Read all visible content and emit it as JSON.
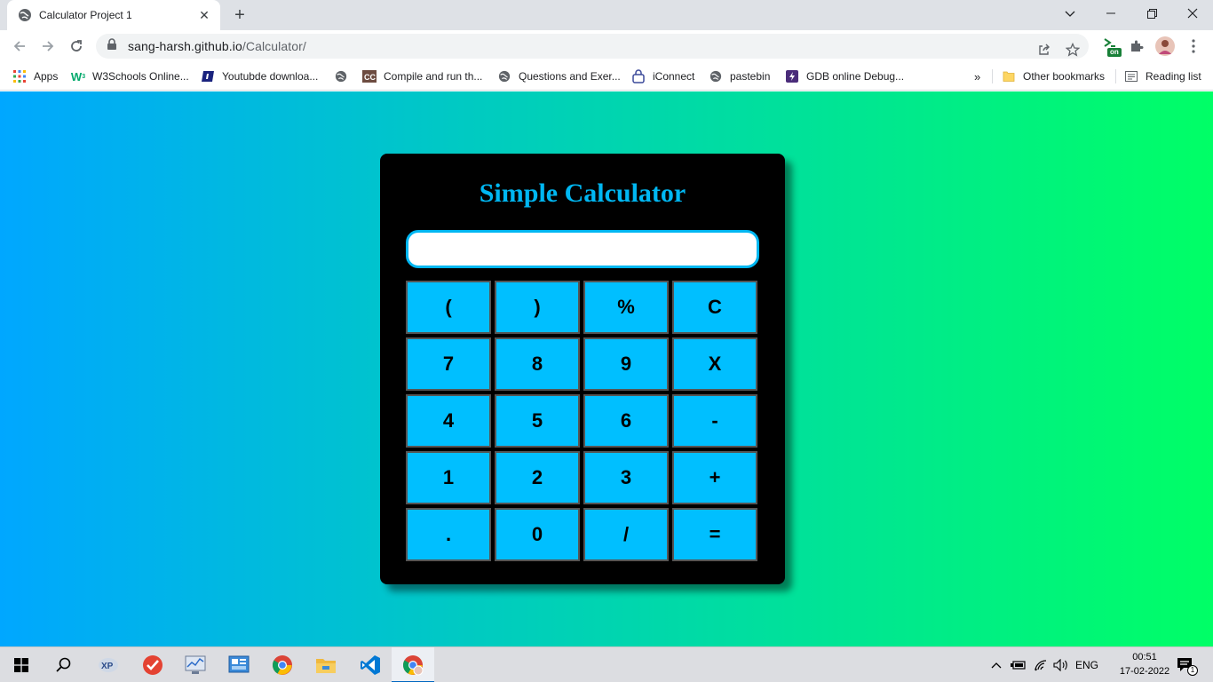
{
  "browser": {
    "tab": {
      "title": "Calculator Project 1"
    },
    "address": {
      "host": "sang-harsh.github.io",
      "path": "/Calculator/"
    },
    "bookmarks": [
      {
        "label": "Apps",
        "icon": "apps-grid-icon"
      },
      {
        "label": "W3Schools Online...",
        "icon": "w3schools-icon"
      },
      {
        "label": "Youtubde downloa...",
        "icon": "bookmark-site-icon"
      },
      {
        "label": "",
        "icon": "globe-icon"
      },
      {
        "label": "Compile and run th...",
        "icon": "cc-icon"
      },
      {
        "label": "Questions and Exer...",
        "icon": "globe-icon"
      },
      {
        "label": "iConnect",
        "icon": "lock-icon"
      },
      {
        "label": "pastebin",
        "icon": "globe-icon"
      },
      {
        "label": "GDB online Debug...",
        "icon": "gdb-icon"
      }
    ],
    "overflow": "»",
    "other_bookmarks": "Other bookmarks",
    "reading_list": "Reading list",
    "extension_badge": "on"
  },
  "calculator": {
    "title": "Simple Calculator",
    "display_value": "",
    "keys": [
      "(",
      ")",
      "%",
      "C",
      "7",
      "8",
      "9",
      "X",
      "4",
      "5",
      "6",
      "-",
      "1",
      "2",
      "3",
      "+",
      ".",
      "0",
      "/",
      "="
    ],
    "accent_color": "#00b7f2",
    "key_color": "#00bfff"
  },
  "taskbar": {
    "language": "ENG",
    "time": "00:51",
    "date": "17-02-2022",
    "notification_count": "1"
  }
}
